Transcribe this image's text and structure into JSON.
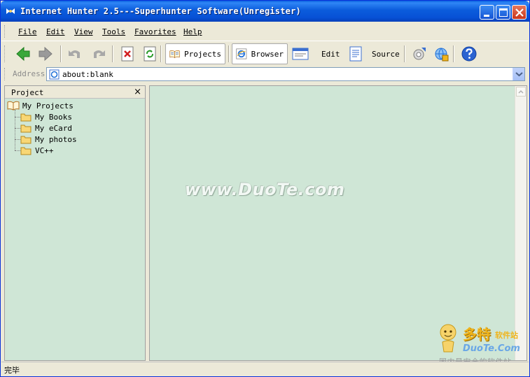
{
  "window": {
    "title": "Internet Hunter 2.5---Superhunter Software(Unregister)"
  },
  "menu": {
    "items": [
      {
        "label": "File"
      },
      {
        "label": "Edit"
      },
      {
        "label": "View"
      },
      {
        "label": "Tools"
      },
      {
        "label": "Favorites"
      },
      {
        "label": "Help"
      }
    ]
  },
  "toolbar": {
    "projects_label": "Projects",
    "browser_label": "Browser",
    "edit_label": "Edit",
    "source_label": "Source"
  },
  "address": {
    "label": "Address",
    "value": "about:blank"
  },
  "project_panel": {
    "title": "Project",
    "root": "My Projects",
    "items": [
      {
        "label": "My Books"
      },
      {
        "label": "My eCard"
      },
      {
        "label": "My photos"
      },
      {
        "label": "VC++"
      }
    ]
  },
  "browser": {
    "watermark": "www.DuoTe.com"
  },
  "branding": {
    "name": "多特",
    "sub": "软件站",
    "url": "DuoTe.Com",
    "tagline": "国内最安全的软件站"
  },
  "status": {
    "text": "完毕"
  },
  "colors": {
    "title_bar": "#0b5cdc",
    "panel_bg": "#cfe6d6",
    "chrome": "#ece9d8"
  }
}
